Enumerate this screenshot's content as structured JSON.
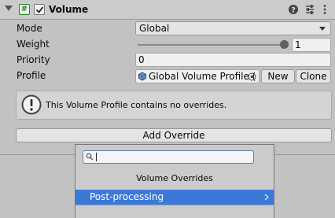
{
  "component": {
    "title": "Volume",
    "enabled": true,
    "icons": [
      "help-icon",
      "presets-icon",
      "more-icon"
    ]
  },
  "fields": {
    "mode": {
      "label": "Mode",
      "value": "Global"
    },
    "weight": {
      "label": "Weight",
      "value": "1",
      "slider_fraction": 1.0
    },
    "priority": {
      "label": "Priority",
      "value": "0"
    },
    "profile": {
      "label": "Profile",
      "value": "Global Volume Profile (",
      "new_label": "New",
      "clone_label": "Clone"
    }
  },
  "help": {
    "text": "This Volume Profile contains no overrides."
  },
  "add_override": {
    "label": "Add Override"
  },
  "popup": {
    "search_value": "",
    "title": "Volume Overrides",
    "items": [
      {
        "label": "Post-processing",
        "selected": true
      }
    ]
  },
  "colors": {
    "selection": "#3a79d7",
    "component_icon": "#2e7d32"
  }
}
